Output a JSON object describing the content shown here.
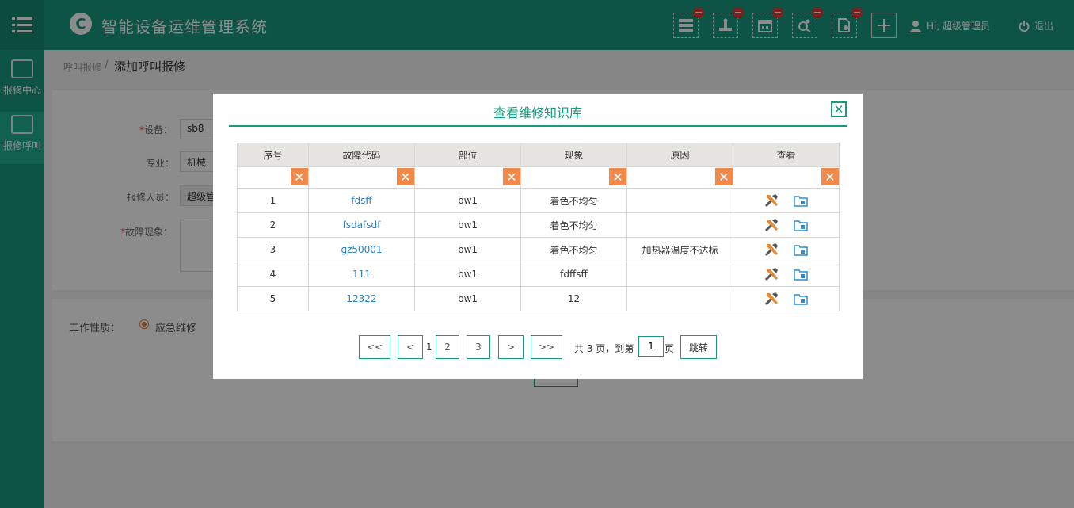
{
  "header": {
    "menu_icon": "menu-icon",
    "logo_text": "C",
    "title": "智能设备运维管理系统",
    "toolbar": [
      {
        "icon": "server-icon"
      },
      {
        "icon": "machine-icon"
      },
      {
        "icon": "calendar-icon"
      },
      {
        "icon": "search-gear-icon"
      },
      {
        "icon": "document-gear-icon"
      },
      {
        "icon": "plus-icon"
      }
    ],
    "user_greeting": "Hi, 超级管理员",
    "logout_label": "退出"
  },
  "sidebar": {
    "items": [
      {
        "label": "报修中心",
        "icon": "monitor-icon"
      },
      {
        "label": "报修呼叫",
        "icon": "alarm-icon"
      }
    ]
  },
  "breadcrumb": {
    "parent": "呼叫报修",
    "separator": "/",
    "current": "添加呼叫报修"
  },
  "form": {
    "device_label": "设备：",
    "device_value": "sb8",
    "specialty_label": "专业：",
    "specialty_value": "机械",
    "reporter_label": "报修人员：",
    "reporter_value": "超级管",
    "fault_label": "故障现象：",
    "required_mark": "*",
    "work_nature_label": "工作性质：",
    "work_nature_option": "应急维修"
  },
  "modal": {
    "title": "查看维修知识库",
    "close_symbol": "✕",
    "clear_symbol": "✕",
    "columns": [
      "序号",
      "故障代码",
      "部位",
      "现象",
      "原因",
      "查看"
    ],
    "rows": [
      {
        "no": "1",
        "code": "fdsff",
        "part": "bw1",
        "phenomenon": "着色不均匀",
        "cause": ""
      },
      {
        "no": "2",
        "code": "fsdafsdf",
        "part": "bw1",
        "phenomenon": "着色不均匀",
        "cause": ""
      },
      {
        "no": "3",
        "code": "gz50001",
        "part": "bw1",
        "phenomenon": "着色不均匀",
        "cause": "加热器温度不达标"
      },
      {
        "no": "4",
        "code": "111",
        "part": "bw1",
        "phenomenon": "fdffsff",
        "cause": ""
      },
      {
        "no": "5",
        "code": "12322",
        "part": "bw1",
        "phenomenon": "12",
        "cause": ""
      }
    ],
    "action_icons": [
      "tools-icon",
      "folder-icon"
    ]
  },
  "pagination": {
    "first": "<<",
    "prev": "<",
    "current": "1",
    "pages": [
      "2",
      "3"
    ],
    "next": ">",
    "last": ">>",
    "summary": "共 3 页，到第",
    "page_input": "1",
    "page_suffix": "页",
    "go_label": "跳转"
  },
  "colors": {
    "primary": "#1a9a80",
    "accent_orange": "#f0894a",
    "link": "#2a7fc4",
    "badge": "#e23a3a"
  }
}
